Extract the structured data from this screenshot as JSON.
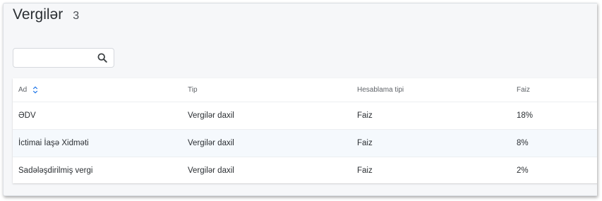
{
  "header": {
    "title": "Vergilər",
    "count": "3"
  },
  "search": {
    "value": "",
    "placeholder": ""
  },
  "table": {
    "columns": [
      "Ad",
      "Tip",
      "Hesablama tipi",
      "Faiz"
    ],
    "rows": [
      [
        "ƏDV",
        "Vergilər daxil",
        "Faiz",
        "18%"
      ],
      [
        "İctimai İaşə Xidməti",
        "Vergilər daxil",
        "Faiz",
        "8%"
      ],
      [
        "Sadələşdirilmiş vergi",
        "Vergilər daxil",
        "Faiz",
        "2%"
      ]
    ]
  },
  "icons": {
    "search": "search-icon",
    "sort": "sort-icon"
  },
  "colors": {
    "page_bg": "#f6f7f9",
    "highlight_row": "#f5f9fd",
    "accent": "#1a73e8"
  }
}
